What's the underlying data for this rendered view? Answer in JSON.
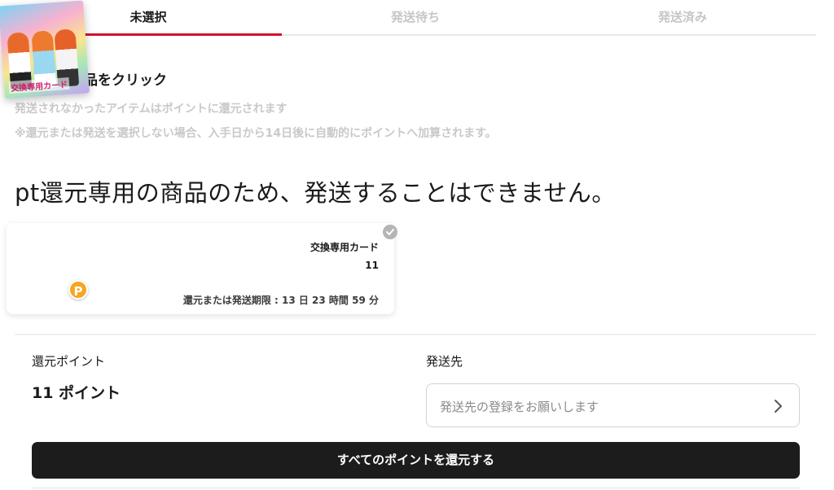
{
  "tabs": [
    {
      "label": "未選択",
      "active": true
    },
    {
      "label": "発送待ち",
      "active": false
    },
    {
      "label": "発送済み",
      "active": false
    }
  ],
  "colors": {
    "accent": "#d0142c",
    "primary_button": "#1c1c1c",
    "muted_text": "#c9c9c9"
  },
  "instructions": {
    "heading": "発送する商品をクリック",
    "note1": "発送されなかったアイテムはポイントに還元されます",
    "note2": "※還元または発送を選択しない場合、入手日から14日後に自動的にポイントへ加算されます。"
  },
  "message": "pt還元専用の商品のため、発送することはできません。",
  "item": {
    "title": "交換専用カード",
    "count": "11",
    "deadline": "還元または発送期限 : 13 日 23 時間 59 分",
    "thumb_text": "交換専用カード",
    "badge": "P",
    "check_icon": "check-circle-icon"
  },
  "summary": {
    "refund_label": "還元ポイント",
    "refund_value": "11 ポイント",
    "ship_label": "発送先",
    "ship_placeholder": "発送先の登録をお願いします",
    "chevron_icon": "chevron-right-icon"
  },
  "actions": {
    "refund_all": "すべてのポイントを還元する"
  }
}
